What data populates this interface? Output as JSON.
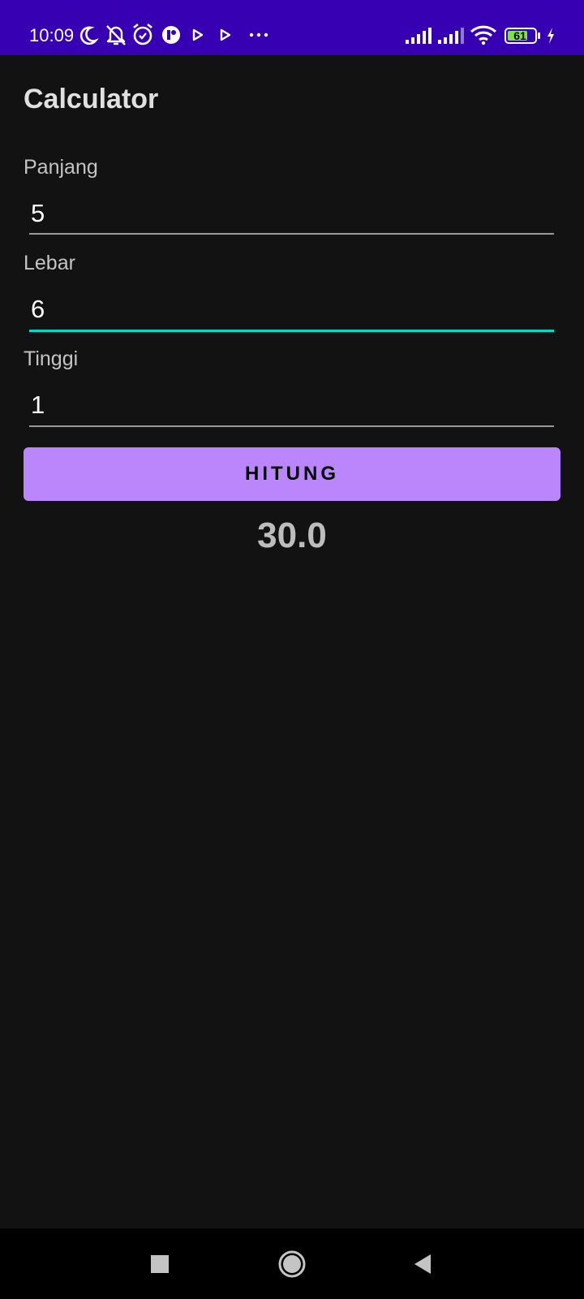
{
  "status_bar": {
    "time": "10:09",
    "battery_level": "61",
    "icons": [
      "moon-icon",
      "bell-off-icon",
      "alarm-icon",
      "app-icon",
      "play-icon",
      "play-icon",
      "more-dots-icon",
      "signal-icon",
      "signal-icon",
      "wifi-icon",
      "battery-icon",
      "charging-icon"
    ],
    "color": "#3700b3"
  },
  "app": {
    "title": "Calculator"
  },
  "fields": [
    {
      "label": "Panjang",
      "value": "5"
    },
    {
      "label": "Lebar",
      "value": "6"
    },
    {
      "label": "Tinggi",
      "value": "1"
    }
  ],
  "button": {
    "label": "HITUNG",
    "color": "#bb86fc"
  },
  "result": {
    "value": "30.0"
  },
  "accent_color": "#03dac5"
}
